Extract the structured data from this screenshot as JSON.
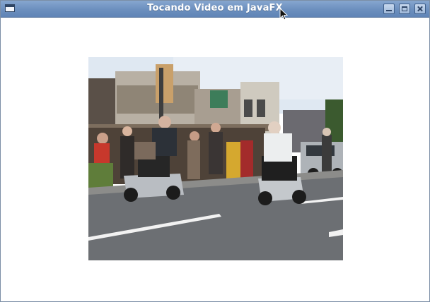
{
  "window": {
    "title": "Tocando Video em JavaFX",
    "buttons": [
      "minimize",
      "maximize",
      "close"
    ]
  },
  "icons": [
    "app-window-icon",
    "minimize-icon",
    "maximize-icon",
    "close-icon",
    "mouse-pointer-icon"
  ],
  "video": {
    "description_icon": "video-frame"
  }
}
